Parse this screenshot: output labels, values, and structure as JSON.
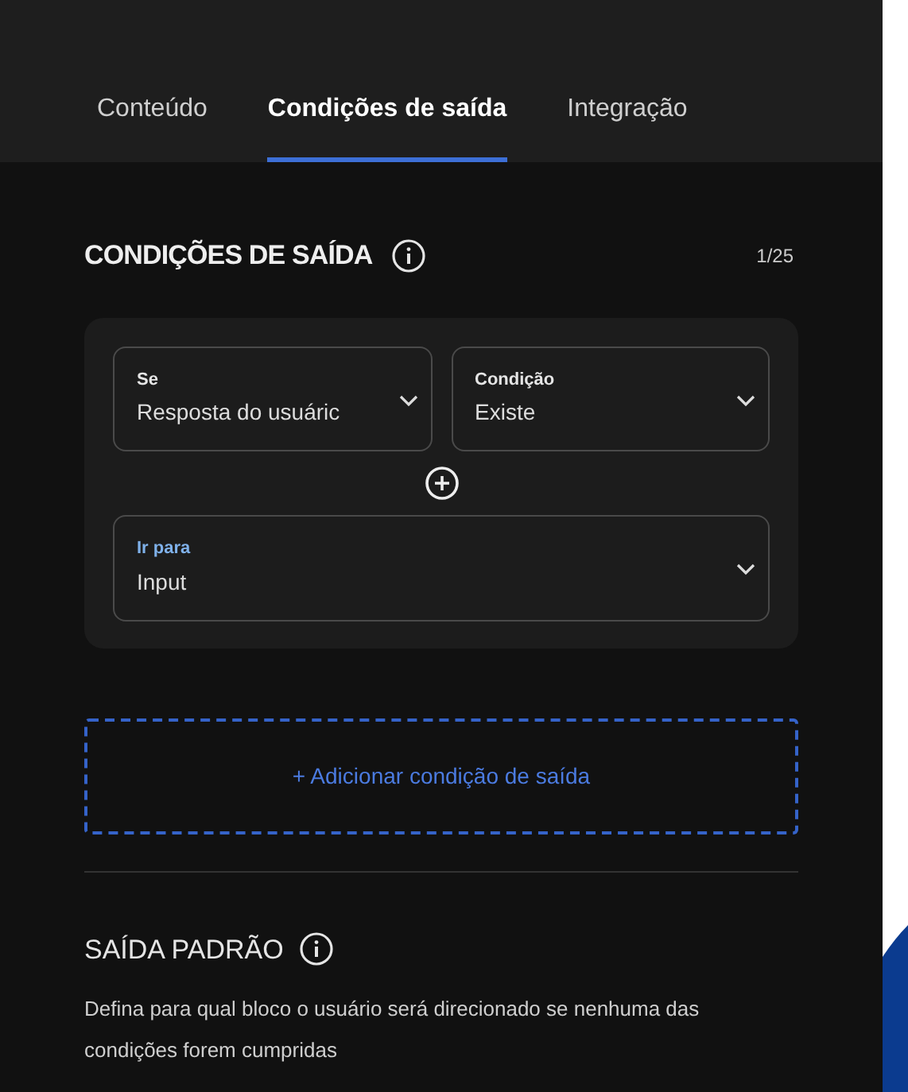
{
  "tabs": [
    {
      "label": "Conteúdo",
      "selected": false
    },
    {
      "label": "Condições de saída",
      "selected": true
    },
    {
      "label": "Integração",
      "selected": false
    }
  ],
  "exit_conditions": {
    "title": "CONDIÇÕES DE SAÍDA",
    "counter": "1/25",
    "condition_fields": [
      {
        "label": "Se",
        "value": "Resposta do usuáric",
        "focused": false
      },
      {
        "label": "Condição",
        "value": "Existe",
        "focused": false
      }
    ],
    "target_field": {
      "label": "Ir para",
      "value": "Input",
      "focused": true
    },
    "add_button": "+ Adicionar condição de saída"
  },
  "default_exit": {
    "title": "SAÍDA PADRÃO",
    "description": "Defina para qual bloco o usuário será direcionado se nenhuma das condições forem cumpridas"
  }
}
